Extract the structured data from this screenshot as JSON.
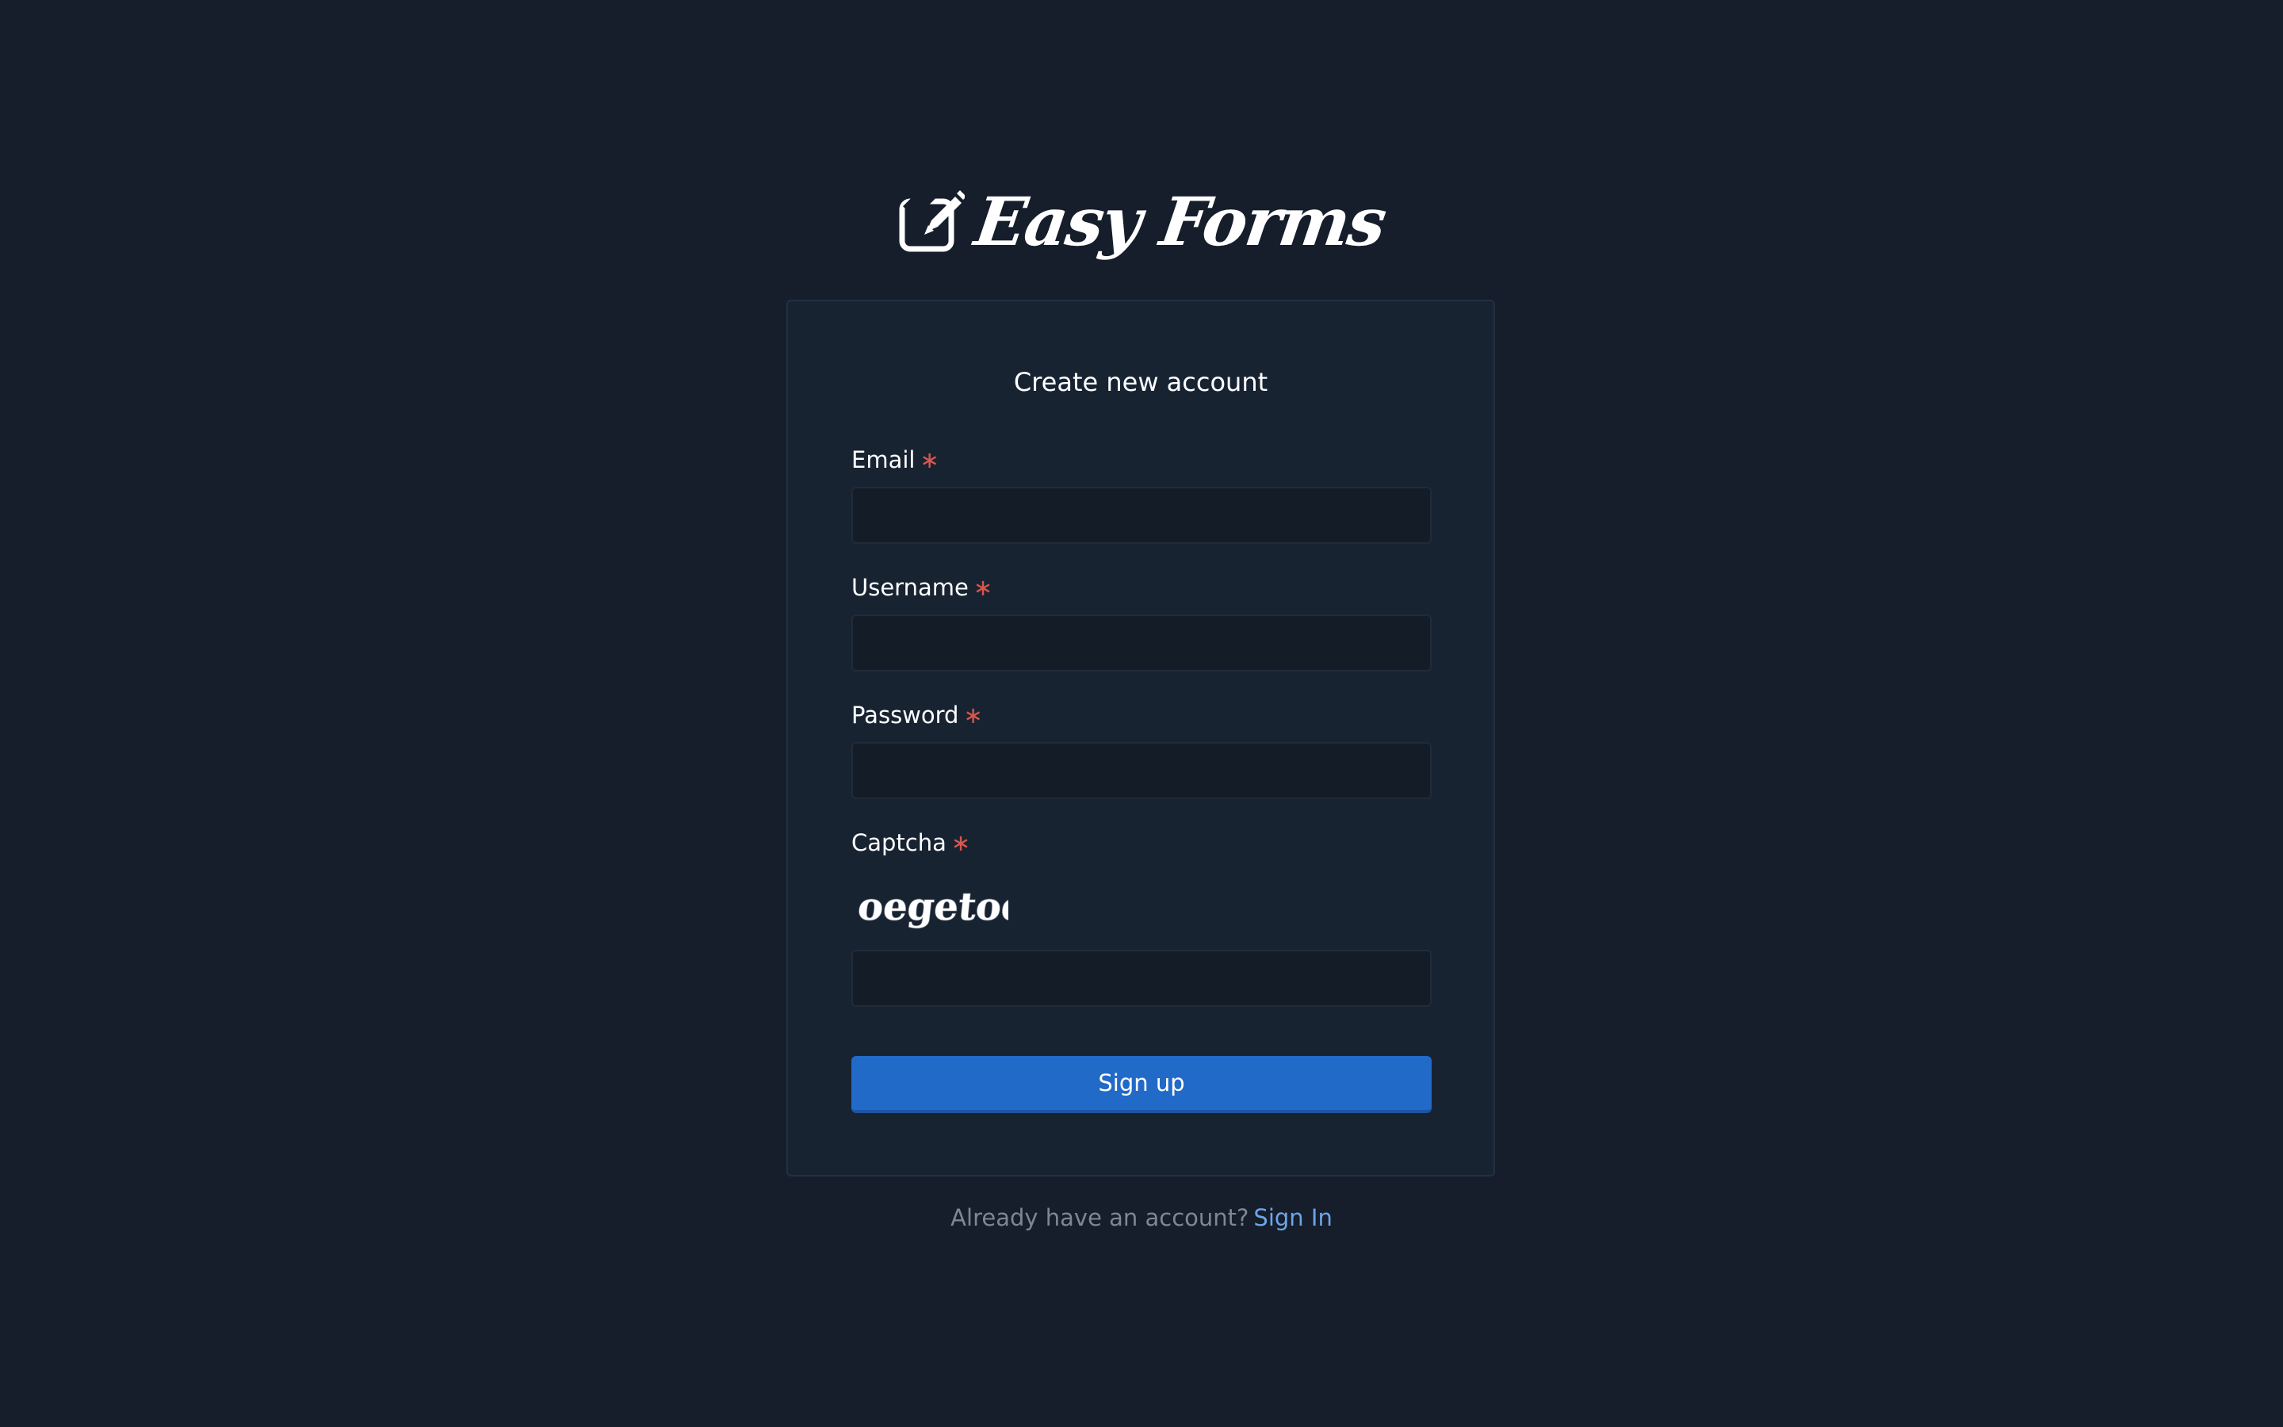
{
  "brand": {
    "name": "Easy Forms",
    "icon": "edit-icon"
  },
  "form": {
    "title": "Create new account",
    "fields": [
      {
        "label": "Email",
        "required_marker": "∗",
        "value": "",
        "placeholder": ""
      },
      {
        "label": "Username",
        "required_marker": "∗",
        "value": "",
        "placeholder": ""
      },
      {
        "label": "Password",
        "required_marker": "∗",
        "value": "",
        "placeholder": ""
      },
      {
        "label": "Captcha",
        "required_marker": "∗",
        "value": "",
        "placeholder": ""
      }
    ],
    "captcha_text": "oegetoq",
    "submit_label": "Sign up"
  },
  "footer": {
    "prompt": "Already have an account?",
    "link_label": "Sign In"
  },
  "colors": {
    "background": "#151e2a",
    "card": "#182332",
    "primary": "#216ac8",
    "required": "#d8574d",
    "link": "#6ea4e8"
  }
}
